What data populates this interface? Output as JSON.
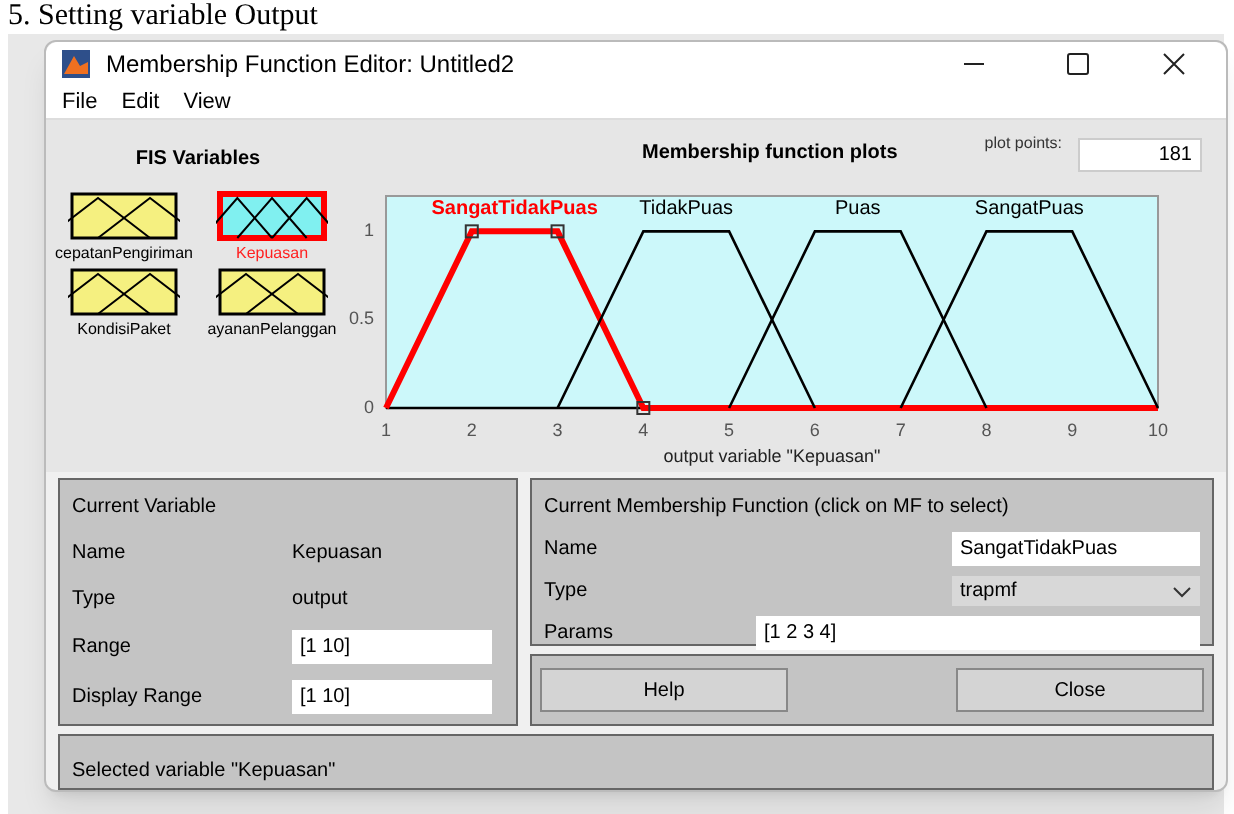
{
  "document": {
    "heading": "5. Setting variable Output"
  },
  "window": {
    "title": "Membership Function Editor: Untitled2"
  },
  "menu": [
    "File",
    "Edit",
    "View"
  ],
  "fis_variables": {
    "title": "FIS Variables",
    "items": [
      {
        "label": "cepatanPengiriman",
        "kind": "input",
        "selected": false
      },
      {
        "label": "Kepuasan",
        "kind": "output",
        "selected": true
      },
      {
        "label": "KondisiPaket",
        "kind": "input",
        "selected": false
      },
      {
        "label": "ayananPelanggan",
        "kind": "input",
        "selected": false
      }
    ]
  },
  "plot": {
    "title": "Membership function plots",
    "points_label": "plot points:",
    "points_value": "181",
    "mf_states": [
      {
        "selected": true
      },
      {
        "selected": false
      },
      {
        "selected": false
      },
      {
        "selected": false
      }
    ],
    "chart_data": {
      "type": "line",
      "xlabel": "output variable \"Kepuasan\"",
      "x": [
        1,
        2,
        3,
        4,
        5,
        6,
        7,
        8,
        9,
        10
      ],
      "xlim": [
        1,
        10
      ],
      "ylim": [
        0,
        1.2
      ],
      "xticks": [
        1,
        2,
        3,
        4,
        5,
        6,
        7,
        8,
        9,
        10
      ],
      "yticks": [
        0,
        0.5,
        1
      ],
      "series": [
        {
          "name": "SangatTidakPuas",
          "color": "#ff0000",
          "values": [
            0,
            1,
            1,
            0,
            0,
            0,
            0,
            0,
            0,
            0
          ]
        },
        {
          "name": "TidakPuas",
          "color": "#000000",
          "values": [
            null,
            null,
            0,
            1,
            1,
            0,
            null,
            null,
            null,
            null
          ]
        },
        {
          "name": "Puas",
          "color": "#000000",
          "values": [
            null,
            null,
            null,
            null,
            0,
            1,
            1,
            0,
            null,
            null
          ]
        },
        {
          "name": "SangatPuas",
          "color": "#000000",
          "values": [
            null,
            null,
            null,
            null,
            null,
            null,
            0,
            1,
            1,
            0
          ]
        }
      ]
    }
  },
  "current_variable": {
    "title": "Current Variable",
    "name_label": "Name",
    "name": "Kepuasan",
    "type_label": "Type",
    "type": "output",
    "range_label": "Range",
    "range": "[1 10]",
    "display_range_label": "Display Range",
    "display_range": "[1 10]"
  },
  "current_mf": {
    "title": "Current Membership Function (click on MF to select)",
    "name_label": "Name",
    "name": "SangatTidakPuas",
    "type_label": "Type",
    "type": "trapmf",
    "params_label": "Params",
    "params": "[1 2 3 4]"
  },
  "buttons": [
    "Help",
    "Close"
  ],
  "status": "Selected variable \"Kepuasan\""
}
